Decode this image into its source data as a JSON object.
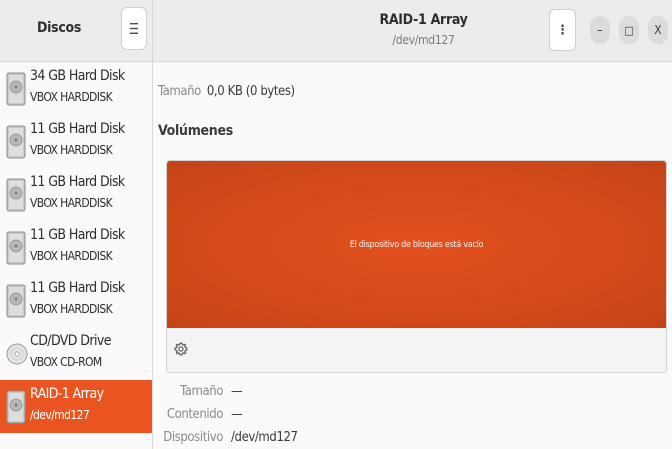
{
  "sidebar": {
    "title": "Discos",
    "menu_icon": "hamburger-icon",
    "drives": [
      {
        "name": "34 GB Hard Disk",
        "model": "VBOX HARDDISK",
        "icon": "hard-disk-icon"
      },
      {
        "name": "11 GB Hard Disk",
        "model": "VBOX HARDDISK",
        "icon": "hard-disk-icon"
      },
      {
        "name": "11 GB Hard Disk",
        "model": "VBOX HARDDISK",
        "icon": "hard-disk-icon"
      },
      {
        "name": "11 GB Hard Disk",
        "model": "VBOX HARDDISK",
        "icon": "hard-disk-icon"
      },
      {
        "name": "11 GB Hard Disk",
        "model": "VBOX HARDDISK",
        "icon": "hard-disk-icon"
      },
      {
        "name": "CD/DVD Drive",
        "model": "VBOX CD-ROM",
        "icon": "optical-disc-icon"
      },
      {
        "name": "RAID-1 Array",
        "model": "/dev/md127",
        "icon": "raid-array-icon",
        "selected": true
      }
    ]
  },
  "header": {
    "title": "RAID-1 Array",
    "subtitle": "/dev/md127",
    "kebab": "⋮",
    "minimize": "–",
    "maximize": "□",
    "close": "X"
  },
  "main": {
    "size_label": "Tamaño",
    "size_value": "0,0 KB (0 bytes)",
    "volumes_title": "Volúmenes",
    "block_message": "El dispositivo de bloques está vacío",
    "props": [
      {
        "key": "Tamaño",
        "value": "—"
      },
      {
        "key": "Contenido",
        "value": "—"
      },
      {
        "key": "Dispositivo",
        "value": "/dev/md127"
      }
    ]
  },
  "colors": {
    "accent": "#e95420",
    "volume_block": "#d64a1a"
  }
}
